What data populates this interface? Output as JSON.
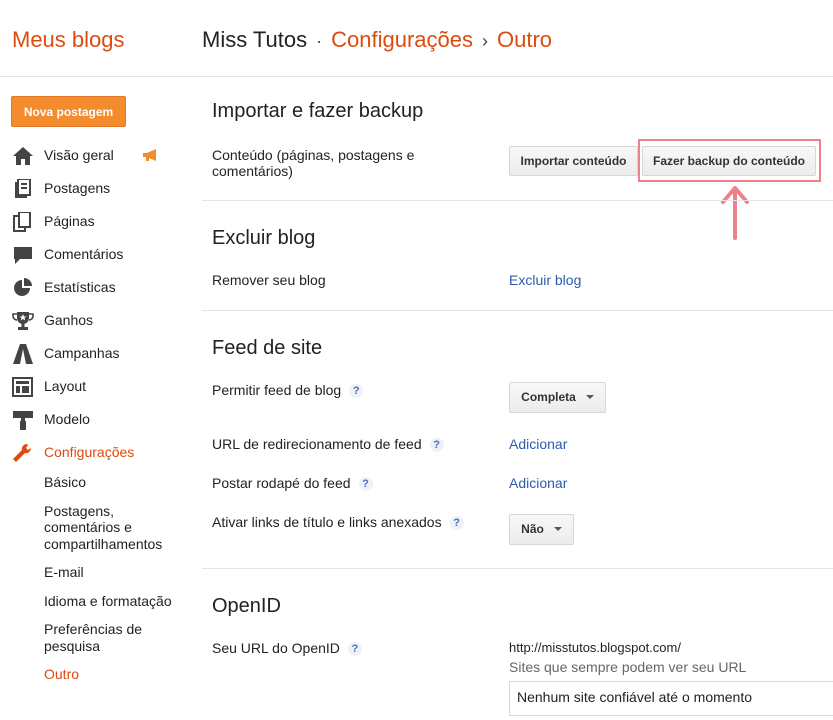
{
  "header": {
    "brand": "Meus blogs",
    "blog_name": "Miss Tutos",
    "dot": "·",
    "crumb_settings": "Configurações",
    "crumb_sep": "›",
    "crumb_current": "Outro"
  },
  "sidebar": {
    "new_post": "Nova postagem",
    "items": [
      {
        "label": "Visão geral",
        "icon": "home-icon"
      },
      {
        "label": "Postagens",
        "icon": "posts-icon"
      },
      {
        "label": "Páginas",
        "icon": "pages-icon"
      },
      {
        "label": "Comentários",
        "icon": "comment-icon"
      },
      {
        "label": "Estatísticas",
        "icon": "pie-chart-icon"
      },
      {
        "label": "Ganhos",
        "icon": "trophy-icon"
      },
      {
        "label": "Campanhas",
        "icon": "campaign-icon"
      },
      {
        "label": "Layout",
        "icon": "layout-icon"
      },
      {
        "label": "Modelo",
        "icon": "paint-roller-icon"
      },
      {
        "label": "Configurações",
        "icon": "wrench-icon"
      }
    ],
    "sub_items": [
      "Básico",
      "Postagens, comentários e compartilhamentos",
      "E-mail",
      "Idioma e formatação",
      "Preferências de pesquisa",
      "Outro"
    ]
  },
  "import_section": {
    "title": "Importar e fazer backup",
    "content_label": "Conteúdo (páginas, postagens e comentários)",
    "import_button": "Importar conteúdo",
    "backup_button": "Fazer backup do conteúdo"
  },
  "delete_section": {
    "title": "Excluir blog",
    "remove_label": "Remover seu blog",
    "delete_link": "Excluir blog"
  },
  "feed_section": {
    "title": "Feed de site",
    "allow_label": "Permitir feed de blog",
    "allow_value": "Completa",
    "redirect_label": "URL de redirecionamento de feed",
    "redirect_link": "Adicionar",
    "footer_label": "Postar rodapé do feed",
    "footer_link": "Adicionar",
    "title_links_label": "Ativar links de título e links anexados",
    "title_links_value": "Não",
    "help": "?"
  },
  "openid_section": {
    "title": "OpenID",
    "url_label": "Seu URL do OpenID",
    "url_value": "http://misstutos.blogspot.com/",
    "sites_caption": "Sites que sempre podem ver seu URL",
    "trusted_value": "Nenhum site confiável até o momento"
  },
  "colors": {
    "accent": "#dd4b0e",
    "button_orange": "#f48b2c",
    "link": "#2a5db0",
    "highlight": "#f0818b"
  }
}
